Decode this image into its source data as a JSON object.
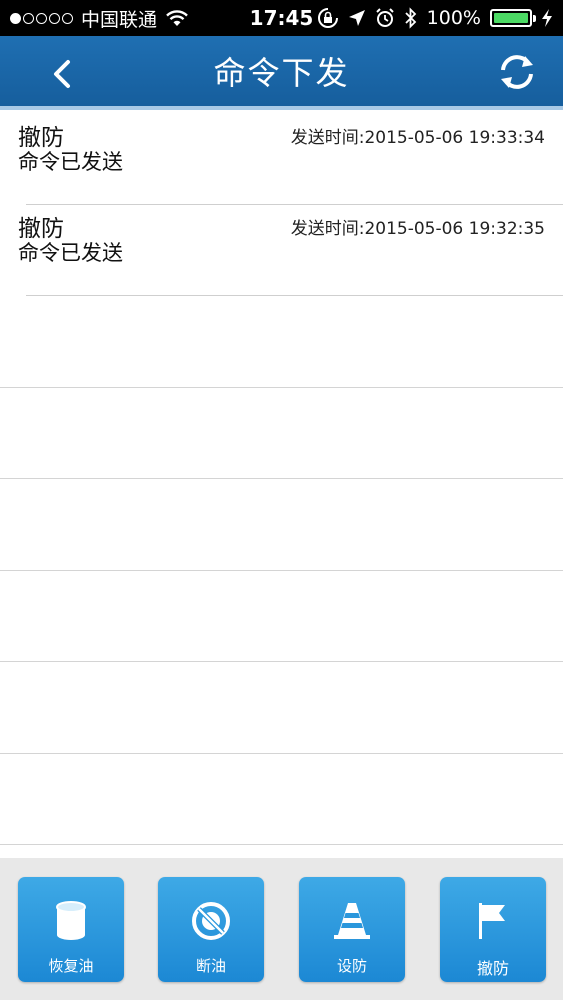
{
  "status_bar": {
    "carrier": "中国联通",
    "time": "17:45",
    "battery": "100%"
  },
  "nav": {
    "title": "命令下发"
  },
  "commands": [
    {
      "name": "撤防",
      "status": "命令已发送",
      "time": "发送时间:2015-05-06 19:33:34"
    },
    {
      "name": "撤防",
      "status": "命令已发送",
      "time": "发送时间:2015-05-06 19:32:35"
    }
  ],
  "toolbar": {
    "restore_oil": "恢复油",
    "cut_oil": "断油",
    "arm": "设防",
    "disarm": "撤防"
  },
  "colors": {
    "nav_bg": "#1f6fb2",
    "button_bg": "#2a97dc",
    "battery": "#4cd964"
  }
}
